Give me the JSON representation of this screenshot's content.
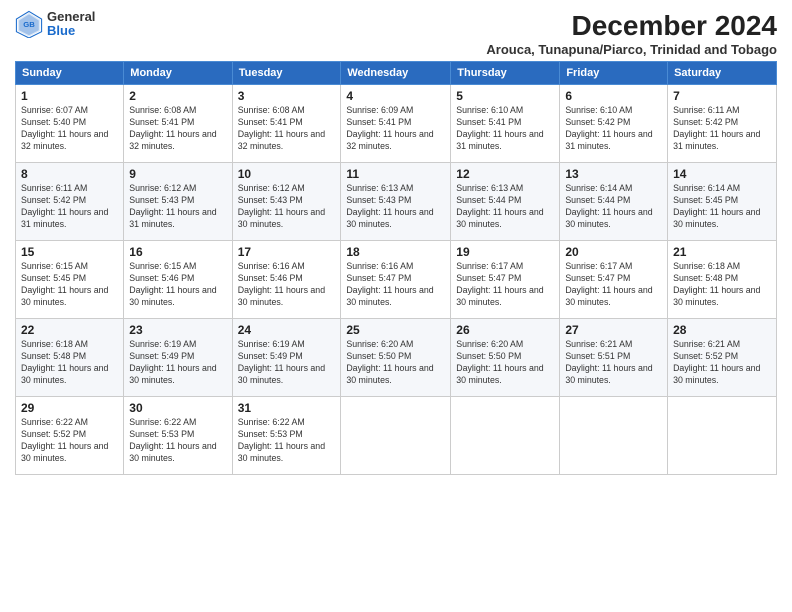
{
  "header": {
    "logo": {
      "general": "General",
      "blue": "Blue"
    },
    "title": "December 2024",
    "subtitle": "Arouca, Tunapuna/Piarco, Trinidad and Tobago"
  },
  "days_of_week": [
    "Sunday",
    "Monday",
    "Tuesday",
    "Wednesday",
    "Thursday",
    "Friday",
    "Saturday"
  ],
  "weeks": [
    [
      {
        "day": "1",
        "sunrise": "6:07 AM",
        "sunset": "5:40 PM",
        "daylight": "11 hours and 32 minutes."
      },
      {
        "day": "2",
        "sunrise": "6:08 AM",
        "sunset": "5:41 PM",
        "daylight": "11 hours and 32 minutes."
      },
      {
        "day": "3",
        "sunrise": "6:08 AM",
        "sunset": "5:41 PM",
        "daylight": "11 hours and 32 minutes."
      },
      {
        "day": "4",
        "sunrise": "6:09 AM",
        "sunset": "5:41 PM",
        "daylight": "11 hours and 32 minutes."
      },
      {
        "day": "5",
        "sunrise": "6:10 AM",
        "sunset": "5:41 PM",
        "daylight": "11 hours and 31 minutes."
      },
      {
        "day": "6",
        "sunrise": "6:10 AM",
        "sunset": "5:42 PM",
        "daylight": "11 hours and 31 minutes."
      },
      {
        "day": "7",
        "sunrise": "6:11 AM",
        "sunset": "5:42 PM",
        "daylight": "11 hours and 31 minutes."
      }
    ],
    [
      {
        "day": "8",
        "sunrise": "6:11 AM",
        "sunset": "5:42 PM",
        "daylight": "11 hours and 31 minutes."
      },
      {
        "day": "9",
        "sunrise": "6:12 AM",
        "sunset": "5:43 PM",
        "daylight": "11 hours and 31 minutes."
      },
      {
        "day": "10",
        "sunrise": "6:12 AM",
        "sunset": "5:43 PM",
        "daylight": "11 hours and 30 minutes."
      },
      {
        "day": "11",
        "sunrise": "6:13 AM",
        "sunset": "5:43 PM",
        "daylight": "11 hours and 30 minutes."
      },
      {
        "day": "12",
        "sunrise": "6:13 AM",
        "sunset": "5:44 PM",
        "daylight": "11 hours and 30 minutes."
      },
      {
        "day": "13",
        "sunrise": "6:14 AM",
        "sunset": "5:44 PM",
        "daylight": "11 hours and 30 minutes."
      },
      {
        "day": "14",
        "sunrise": "6:14 AM",
        "sunset": "5:45 PM",
        "daylight": "11 hours and 30 minutes."
      }
    ],
    [
      {
        "day": "15",
        "sunrise": "6:15 AM",
        "sunset": "5:45 PM",
        "daylight": "11 hours and 30 minutes."
      },
      {
        "day": "16",
        "sunrise": "6:15 AM",
        "sunset": "5:46 PM",
        "daylight": "11 hours and 30 minutes."
      },
      {
        "day": "17",
        "sunrise": "6:16 AM",
        "sunset": "5:46 PM",
        "daylight": "11 hours and 30 minutes."
      },
      {
        "day": "18",
        "sunrise": "6:16 AM",
        "sunset": "5:47 PM",
        "daylight": "11 hours and 30 minutes."
      },
      {
        "day": "19",
        "sunrise": "6:17 AM",
        "sunset": "5:47 PM",
        "daylight": "11 hours and 30 minutes."
      },
      {
        "day": "20",
        "sunrise": "6:17 AM",
        "sunset": "5:47 PM",
        "daylight": "11 hours and 30 minutes."
      },
      {
        "day": "21",
        "sunrise": "6:18 AM",
        "sunset": "5:48 PM",
        "daylight": "11 hours and 30 minutes."
      }
    ],
    [
      {
        "day": "22",
        "sunrise": "6:18 AM",
        "sunset": "5:48 PM",
        "daylight": "11 hours and 30 minutes."
      },
      {
        "day": "23",
        "sunrise": "6:19 AM",
        "sunset": "5:49 PM",
        "daylight": "11 hours and 30 minutes."
      },
      {
        "day": "24",
        "sunrise": "6:19 AM",
        "sunset": "5:49 PM",
        "daylight": "11 hours and 30 minutes."
      },
      {
        "day": "25",
        "sunrise": "6:20 AM",
        "sunset": "5:50 PM",
        "daylight": "11 hours and 30 minutes."
      },
      {
        "day": "26",
        "sunrise": "6:20 AM",
        "sunset": "5:50 PM",
        "daylight": "11 hours and 30 minutes."
      },
      {
        "day": "27",
        "sunrise": "6:21 AM",
        "sunset": "5:51 PM",
        "daylight": "11 hours and 30 minutes."
      },
      {
        "day": "28",
        "sunrise": "6:21 AM",
        "sunset": "5:52 PM",
        "daylight": "11 hours and 30 minutes."
      }
    ],
    [
      {
        "day": "29",
        "sunrise": "6:22 AM",
        "sunset": "5:52 PM",
        "daylight": "11 hours and 30 minutes."
      },
      {
        "day": "30",
        "sunrise": "6:22 AM",
        "sunset": "5:53 PM",
        "daylight": "11 hours and 30 minutes."
      },
      {
        "day": "31",
        "sunrise": "6:22 AM",
        "sunset": "5:53 PM",
        "daylight": "11 hours and 30 minutes."
      },
      null,
      null,
      null,
      null
    ]
  ]
}
